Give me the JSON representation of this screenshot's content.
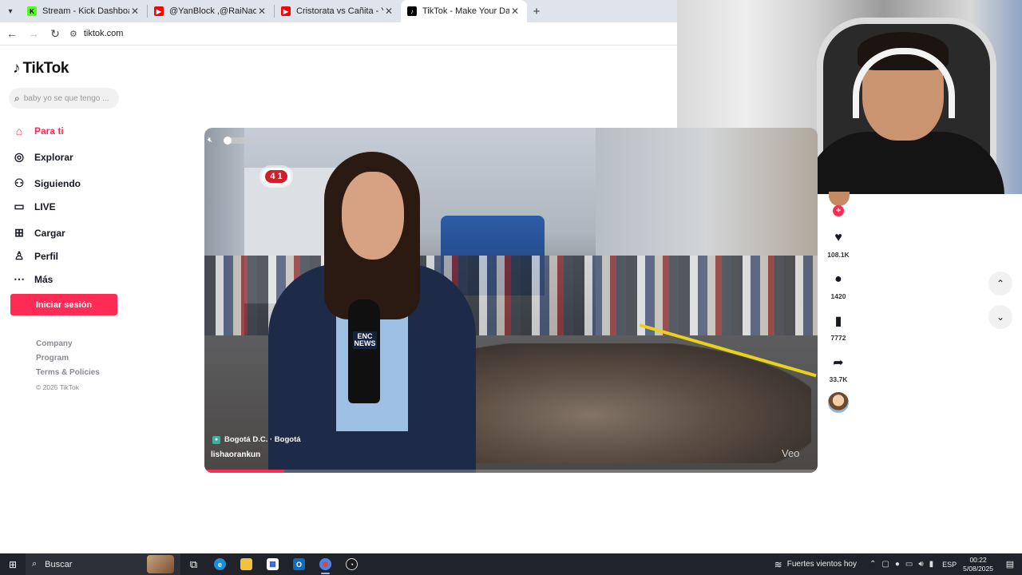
{
  "browser": {
    "tabs": [
      {
        "title": "Stream - Kick Dashboard",
        "favicon": "K",
        "favicon_color": "#53fc18",
        "active": false
      },
      {
        "title": "@YanBlock ,@RaiNao ,@slowja",
        "favicon": "▶",
        "favicon_color": "#ff0000",
        "active": false
      },
      {
        "title": "Cristorata vs Cañita - YouTube",
        "favicon": "▶",
        "favicon_color": "#ff0000",
        "active": false
      },
      {
        "title": "TikTok - Make Your Day",
        "favicon": "♪",
        "favicon_color": "#000000",
        "active": true
      }
    ],
    "url": "tiktok.com"
  },
  "tiktok": {
    "logo_text": "TikTok",
    "search_placeholder": "baby yo se que tengo ...",
    "nav": [
      {
        "label": "Para ti",
        "icon": "home-icon",
        "active": true
      },
      {
        "label": "Explorar",
        "icon": "compass-icon",
        "active": false
      },
      {
        "label": "Siguiendo",
        "icon": "following-icon",
        "active": false
      },
      {
        "label": "LIVE",
        "icon": "live-icon",
        "active": false
      },
      {
        "label": "Cargar",
        "icon": "upload-icon",
        "active": false
      },
      {
        "label": "Perfil",
        "icon": "profile-icon",
        "active": false
      },
      {
        "label": "Más",
        "icon": "more-icon",
        "active": false
      }
    ],
    "login_label": "Iniciar sesión",
    "footer": {
      "company": "Company",
      "program": "Program",
      "terms": "Terms & Policies",
      "copyright": "© 2025 TikTok"
    },
    "accent": "#fe2c55"
  },
  "video": {
    "channel_logo": "4 1",
    "mic_label_line1": "ENC",
    "mic_label_line2": "NEWS",
    "location": "Bogotá D.C. · Bogotá",
    "author": "lishaorankun",
    "watermark": "Veo",
    "progress": 0.13
  },
  "actions": {
    "likes": "108.1K",
    "comments": "1420",
    "saves": "7772",
    "shares": "33.7K"
  },
  "taskbar": {
    "search_label": "Buscar",
    "weather": "Fuertes vientos hoy",
    "language": "ESP",
    "time": "00:22",
    "date": "5/08/2025"
  }
}
